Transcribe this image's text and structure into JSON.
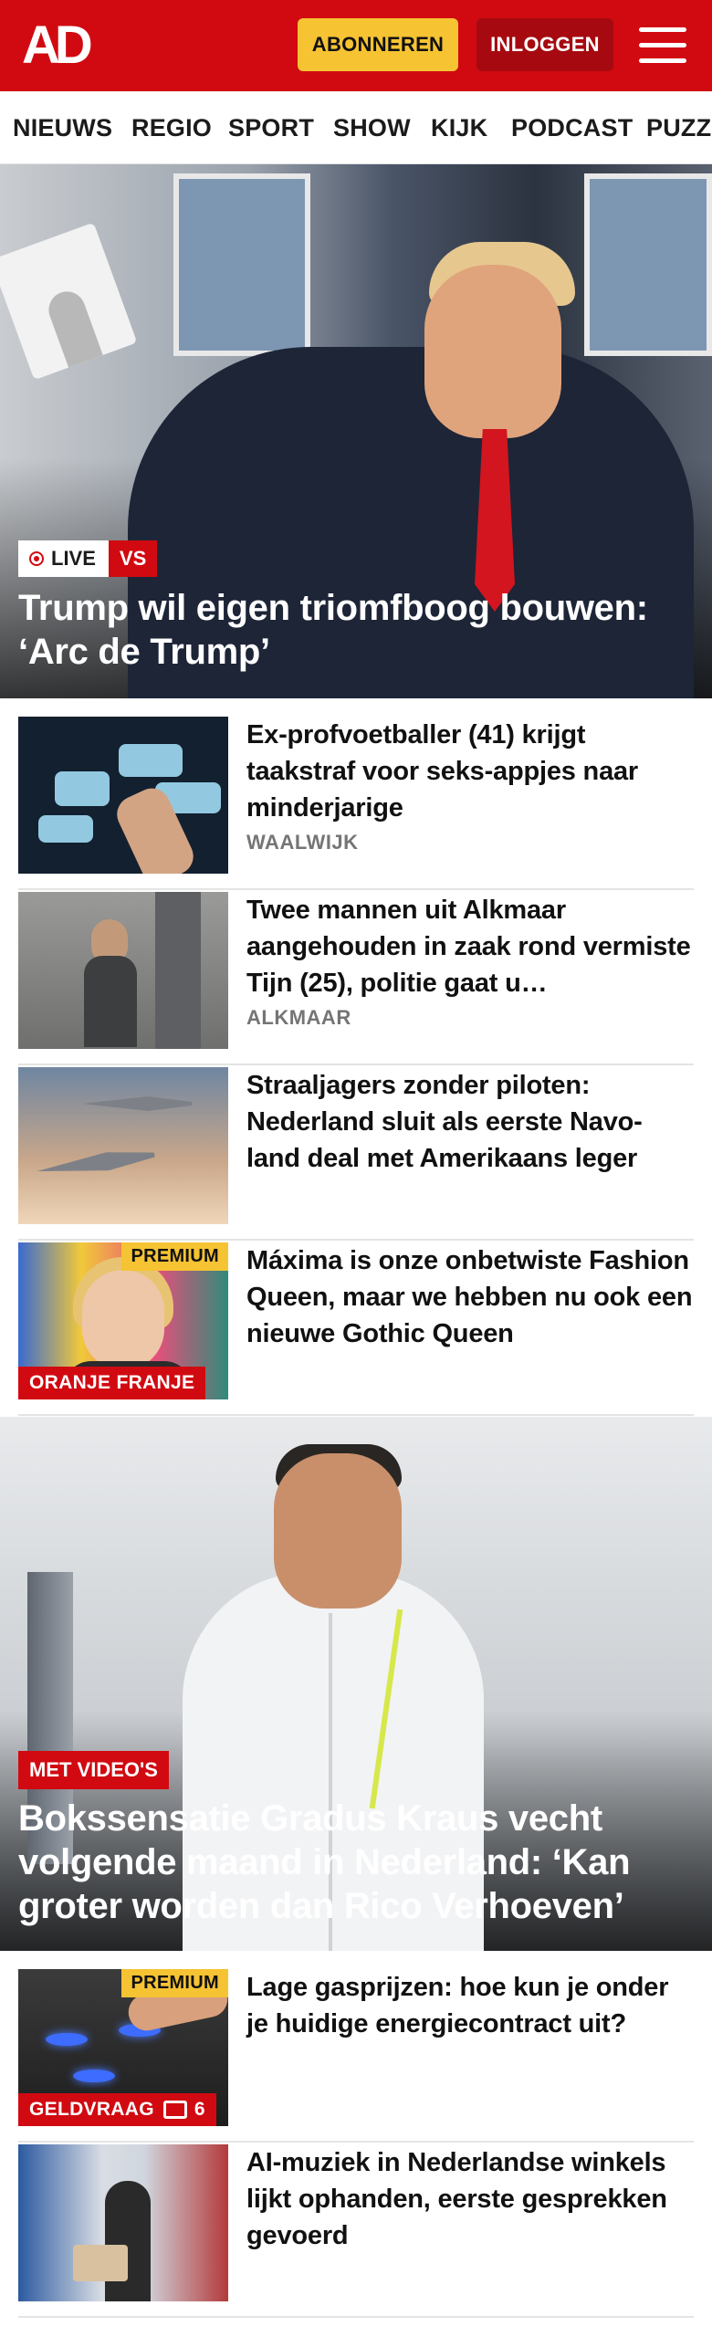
{
  "header": {
    "logo": "AD",
    "subscribe_label": "ABONNEREN",
    "login_label": "INLOGGEN",
    "brand_color": "#d10a11"
  },
  "nav": {
    "items": [
      "NIEUWS",
      "REGIO",
      "SPORT",
      "SHOW",
      "KIJK",
      "PODCAST",
      "PUZZ"
    ]
  },
  "hero": {
    "live_label": "LIVE",
    "tag": "VS",
    "title": "Trump wil eigen triomfboog bouwen: ‘Arc de Trump’"
  },
  "articles": [
    {
      "title": "Ex-profvoetballer (41) krijgt taakstraf voor seks-appjes naar minderjarige",
      "location": "WAALWIJK"
    },
    {
      "title": "Twee mannen uit Alkmaar aangehouden in zaak rond vermiste Tijn (25), politie gaat u…",
      "location": "ALKMAAR"
    },
    {
      "title": "Straaljagers zonder piloten: Nederland sluit als eerste Navo-land deal met Amerikaans leger"
    },
    {
      "title": "Máxima is onze onbetwiste Fashion Queen, maar we hebben nu ook een nieuwe Gothic Queen",
      "premium": "PREMIUM",
      "tag": "ORANJE FRANJE"
    }
  ],
  "hero2": {
    "tag": "MET VIDEO'S",
    "title": "Bokssensatie Gradus Kraus vecht volgende maand in Nederland: ‘Kan groter worden dan Rico Verhoeven’"
  },
  "articles2": [
    {
      "title": "Lage gasprijzen: hoe kun je onder je huidige energiecontract uit?",
      "premium": "PREMIUM",
      "tag": "GELDVRAAG",
      "comments": "6"
    },
    {
      "title": "AI-muziek in Nederlandse winkels lijkt ophanden, eerste gesprekken gevoerd"
    }
  ]
}
